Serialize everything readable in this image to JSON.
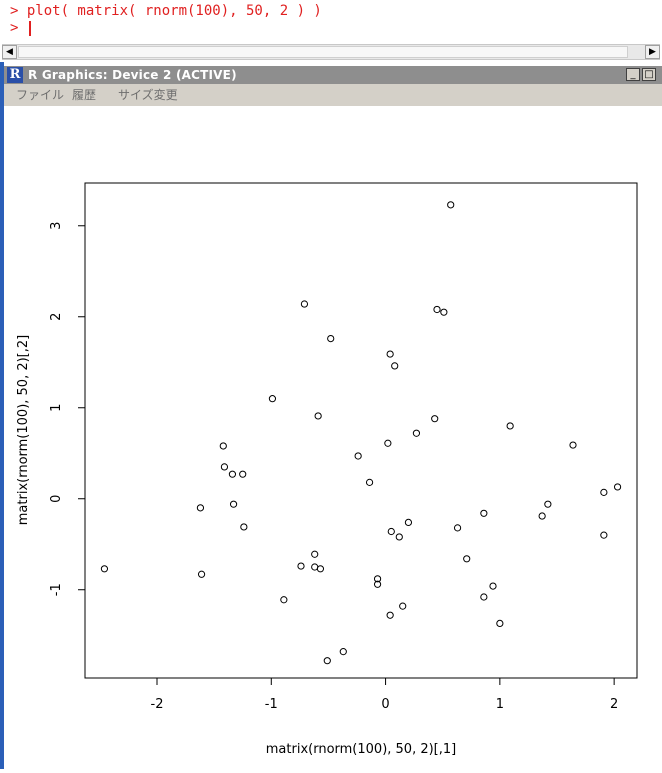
{
  "console": {
    "line1": "> plot( matrix( rnorm(100), 50, 2 ) )",
    "line2": "> "
  },
  "window": {
    "title": "R Graphics: Device 2 (ACTIVE)",
    "logo": "R"
  },
  "menu": {
    "file": "ファイル",
    "history": "履歴",
    "resize": "サイズ変更"
  },
  "icons": {
    "scroll_left": "arrow-left-icon",
    "scroll_right": "arrow-right-icon",
    "minimize": "minimize-icon",
    "maximize": "maximize-icon"
  },
  "chart_data": {
    "type": "scatter",
    "xlabel": "matrix(rnorm(100), 50, 2)[,1]",
    "ylabel": "matrix(rnorm(100), 50, 2)[,2]",
    "xlim": [
      -2.63,
      2.2
    ],
    "ylim": [
      -1.97,
      3.47
    ],
    "xticks": [
      -2,
      -1,
      0,
      1,
      2
    ],
    "yticks": [
      -1,
      0,
      1,
      2,
      3
    ],
    "xtick_labels": [
      "-2",
      "-1",
      "0",
      "1",
      "2"
    ],
    "ytick_labels": [
      "-1",
      "0",
      "1",
      "2",
      "3"
    ],
    "grid": false,
    "points": [
      [
        -2.46,
        -0.77
      ],
      [
        -1.62,
        -0.1
      ],
      [
        -1.61,
        -0.83
      ],
      [
        -1.42,
        0.58
      ],
      [
        -1.41,
        0.35
      ],
      [
        -1.34,
        0.27
      ],
      [
        -1.33,
        -0.06
      ],
      [
        -1.25,
        0.27
      ],
      [
        -1.24,
        -0.31
      ],
      [
        -0.99,
        1.1
      ],
      [
        -0.89,
        -1.11
      ],
      [
        -0.74,
        -0.74
      ],
      [
        -0.71,
        2.14
      ],
      [
        -0.62,
        -0.61
      ],
      [
        -0.62,
        -0.75
      ],
      [
        -0.59,
        0.91
      ],
      [
        -0.57,
        -0.77
      ],
      [
        -0.51,
        -1.78
      ],
      [
        -0.48,
        1.76
      ],
      [
        -0.37,
        -1.68
      ],
      [
        -0.24,
        0.47
      ],
      [
        -0.14,
        0.18
      ],
      [
        -0.07,
        -0.88
      ],
      [
        -0.07,
        -0.94
      ],
      [
        0.02,
        0.61
      ],
      [
        0.04,
        -1.28
      ],
      [
        0.04,
        1.59
      ],
      [
        0.05,
        -0.36
      ],
      [
        0.08,
        1.46
      ],
      [
        0.12,
        -0.42
      ],
      [
        0.15,
        -1.18
      ],
      [
        0.2,
        -0.26
      ],
      [
        0.27,
        0.72
      ],
      [
        0.43,
        0.88
      ],
      [
        0.45,
        2.08
      ],
      [
        0.51,
        2.05
      ],
      [
        0.57,
        3.23
      ],
      [
        0.63,
        -0.32
      ],
      [
        0.71,
        -0.66
      ],
      [
        0.86,
        -0.16
      ],
      [
        0.86,
        -1.08
      ],
      [
        0.94,
        -0.96
      ],
      [
        1.0,
        -1.37
      ],
      [
        1.09,
        0.8
      ],
      [
        1.37,
        -0.19
      ],
      [
        1.42,
        -0.06
      ],
      [
        1.64,
        0.59
      ],
      [
        1.91,
        0.07
      ],
      [
        1.91,
        -0.4
      ],
      [
        2.03,
        0.13
      ]
    ]
  }
}
